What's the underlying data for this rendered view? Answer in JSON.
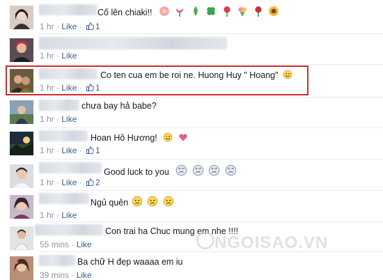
{
  "comments": [
    {
      "text": "Cố lên chiaki!!",
      "time": "1 hr",
      "like": "Like",
      "count": "1"
    },
    {
      "text": "",
      "time": "1 hr",
      "like": "Like",
      "count": ""
    },
    {
      "text": "Co ten cua em be roi ne. Huong Huy \" Hoang\"",
      "time": "1 hr",
      "like": "Like",
      "count": "1"
    },
    {
      "text": "chưa bay hả babe?",
      "time": "1 hr",
      "like": "Like",
      "count": ""
    },
    {
      "text": "Hoan Hô Hương!",
      "time": "1 hr",
      "like": "Like",
      "count": "1"
    },
    {
      "text": "Good luck to you",
      "time": "1 hr",
      "like": "Like",
      "count": "2"
    },
    {
      "text": "Ngủ quên",
      "time": "1 hr",
      "like": "Like",
      "count": ""
    },
    {
      "text": "Con trai ha Chuc mung em nhe !!!!",
      "time": "55 mins",
      "like": "Like",
      "count": ""
    },
    {
      "text": "Ba chữ H đẹp waaaa em iu",
      "time": "39 mins",
      "like": "Like",
      "count": ""
    }
  ],
  "colors": {
    "link": "#3b5998",
    "meta": "#90949c",
    "highlight": "#d12b2b"
  },
  "watermark": "NGOISAO.VN"
}
